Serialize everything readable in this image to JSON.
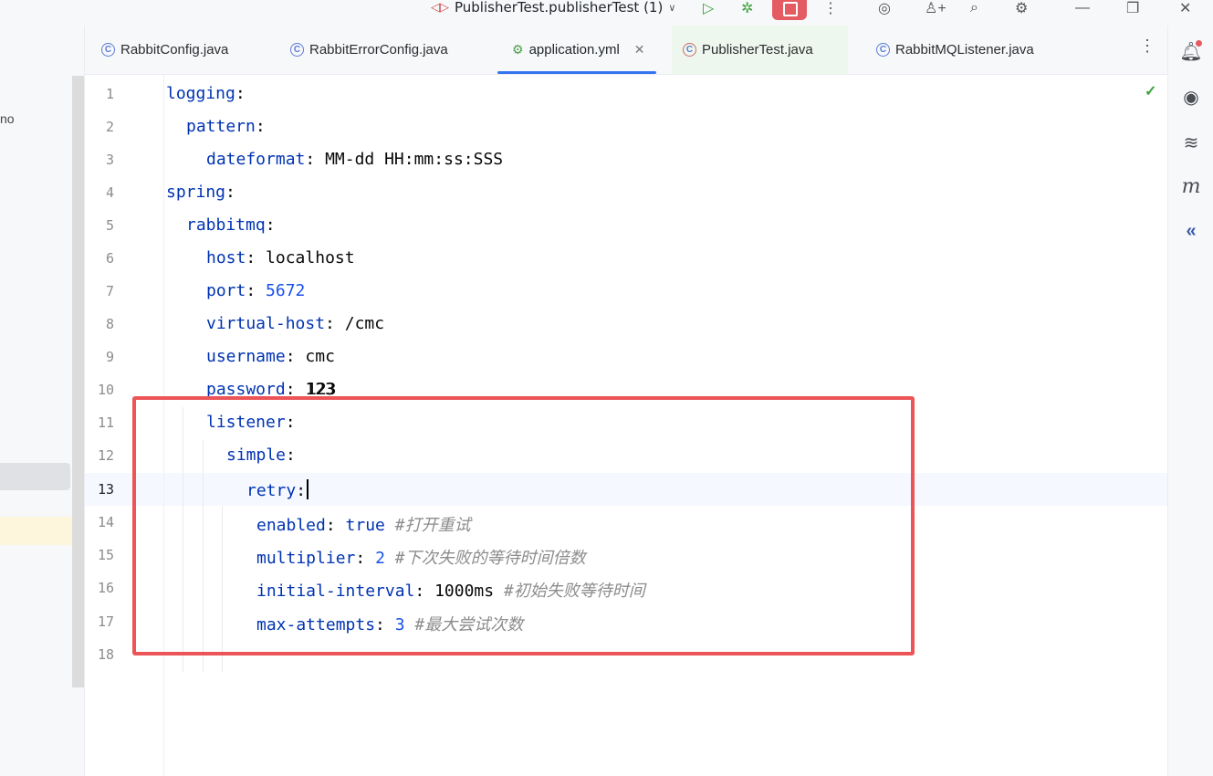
{
  "title_bar": {
    "run_config": "PublisherTest.publisherTest (1)",
    "icons": [
      "run-icon",
      "debug-icon",
      "stop-icon",
      "more-icon",
      "spiral-icon",
      "add-user-icon",
      "search-icon",
      "settings-icon",
      "minimize-icon",
      "restore-icon",
      "close-icon"
    ]
  },
  "left_panel": {
    "fragment": "no"
  },
  "tabs": [
    {
      "label": "RabbitConfig.java",
      "icon": "class-icon",
      "active": false
    },
    {
      "label": "RabbitErrorConfig.java",
      "icon": "class-icon",
      "active": false
    },
    {
      "label": "application.yml",
      "icon": "yaml-icon",
      "active": true
    },
    {
      "label": "PublisherTest.java",
      "icon": "test-class-icon",
      "active": false
    },
    {
      "label": "RabbitMQListener.java",
      "icon": "class-icon",
      "active": false
    }
  ],
  "right_tools": [
    "notifications-icon",
    "ai-assistant-icon",
    "database-icon",
    "maven-icon",
    "collapse-icon"
  ],
  "editor": {
    "current_line": 13,
    "lines": [
      {
        "n": "1",
        "key": "logging",
        "sep": ":",
        "value": "",
        "comment": ""
      },
      {
        "n": "2",
        "key": "pattern",
        "sep": ":",
        "value": "",
        "comment": ""
      },
      {
        "n": "3",
        "key": "dateformat",
        "sep": ": ",
        "value": "MM-dd HH:mm:ss:SSS",
        "comment": ""
      },
      {
        "n": "4",
        "key": "spring",
        "sep": ":",
        "value": "",
        "comment": ""
      },
      {
        "n": "5",
        "key": "rabbitmq",
        "sep": ":",
        "value": "",
        "comment": ""
      },
      {
        "n": "6",
        "key": "host",
        "sep": ": ",
        "value": "localhost",
        "comment": ""
      },
      {
        "n": "7",
        "key": "port",
        "sep": ": ",
        "value": "5672",
        "comment": ""
      },
      {
        "n": "8",
        "key": "virtual-host",
        "sep": ": ",
        "value": "/cmc",
        "comment": ""
      },
      {
        "n": "9",
        "key": "username",
        "sep": ": ",
        "value": "cmc",
        "comment": ""
      },
      {
        "n": "10",
        "key": "password",
        "sep": ": ",
        "value": "123",
        "comment": ""
      },
      {
        "n": "11",
        "key": "listener",
        "sep": ":",
        "value": "",
        "comment": ""
      },
      {
        "n": "12",
        "key": "simple",
        "sep": ":",
        "value": "",
        "comment": ""
      },
      {
        "n": "13",
        "key": "retry",
        "sep": ":",
        "value": "",
        "comment": ""
      },
      {
        "n": "14",
        "key": "enabled",
        "sep": ": ",
        "value": "true",
        "comment": "#打开重试"
      },
      {
        "n": "15",
        "key": "multiplier",
        "sep": ": ",
        "value": "2",
        "comment": "#下次失败的等待时间倍数"
      },
      {
        "n": "16",
        "key": "initial-interval",
        "sep": ": ",
        "value": "1000ms",
        "comment": "#初始失败等待时间"
      },
      {
        "n": "17",
        "key": "max-attempts",
        "sep": ": ",
        "value": "3",
        "comment": "#最大尝试次数"
      },
      {
        "n": "18",
        "key": "",
        "sep": "",
        "value": "",
        "comment": ""
      }
    ]
  },
  "colors": {
    "key": "#0033b3",
    "number": "#1750eb",
    "comment": "#8c8c8c",
    "accent": "#3574f0",
    "annotation": "#ec5557"
  }
}
